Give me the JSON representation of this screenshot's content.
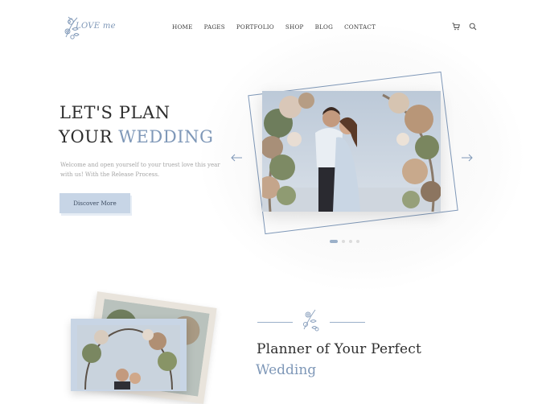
{
  "brand": {
    "logo_text": "LOVE me"
  },
  "nav": {
    "items": [
      {
        "label": "HOME"
      },
      {
        "label": "PAGES"
      },
      {
        "label": "PORTFOLIO"
      },
      {
        "label": "SHOP"
      },
      {
        "label": "BLOG"
      },
      {
        "label": "CONTACT"
      }
    ]
  },
  "header_icons": [
    "cart-icon",
    "search-icon"
  ],
  "hero": {
    "line1": "LET'S PLAN",
    "line2_prefix": "YOUR ",
    "line2_accent": "WEDDING",
    "description": "Welcome and open yourself to your truest love this year with us! With the Release Process.",
    "button_label": "Discover More",
    "slide_count": 4,
    "active_slide": 1,
    "photo_subject": "wedding-couple-photo"
  },
  "planner": {
    "title": "Planner of Your Perfect",
    "subtitle": "Wedding"
  },
  "colors": {
    "accent": "#7f98b8",
    "button_bg": "#c7d5e6",
    "text": "#2d2d2d",
    "muted": "#a5a5a5"
  }
}
